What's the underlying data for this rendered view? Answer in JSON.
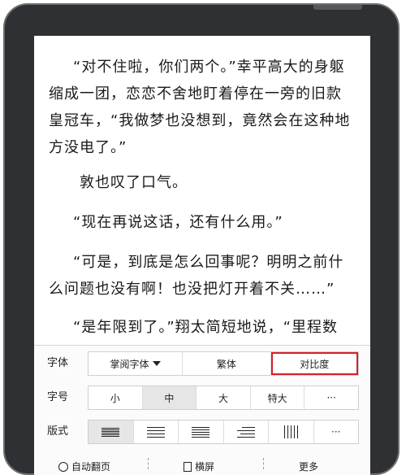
{
  "reader": {
    "lines": [
      "“对不住啦，你们两个。”幸平高大的身躯",
      "缩成一团，恋恋不舍地盯着停在一旁的旧款",
      "皇冠车，“我做梦也没想到，竟然会在这种地",
      "方没电了。”",
      "敦也叹了口气。",
      "“现在再说这话，还有什么用。”",
      "“可是，到底是怎么回事呢？明明之前什",
      "么问题也没有啊！也没把灯开着不关……”",
      "“是年限到了。”翔太简短地说，“里程数"
    ]
  },
  "toolbar": {
    "font": {
      "label": "字体",
      "options": [
        "掌阅字体",
        "繁体",
        "对比度"
      ]
    },
    "size": {
      "label": "字号",
      "options": [
        "小",
        "中",
        "大",
        "特大",
        "···"
      ],
      "selected": "中"
    },
    "layout": {
      "label": "版式",
      "more": "···"
    },
    "bottom": {
      "auto_page": "自动翻页",
      "landscape": "横屏",
      "more": "更多"
    }
  },
  "colors": {
    "highlight": "#d6212b",
    "selected_bg": "#e6e6e6"
  }
}
